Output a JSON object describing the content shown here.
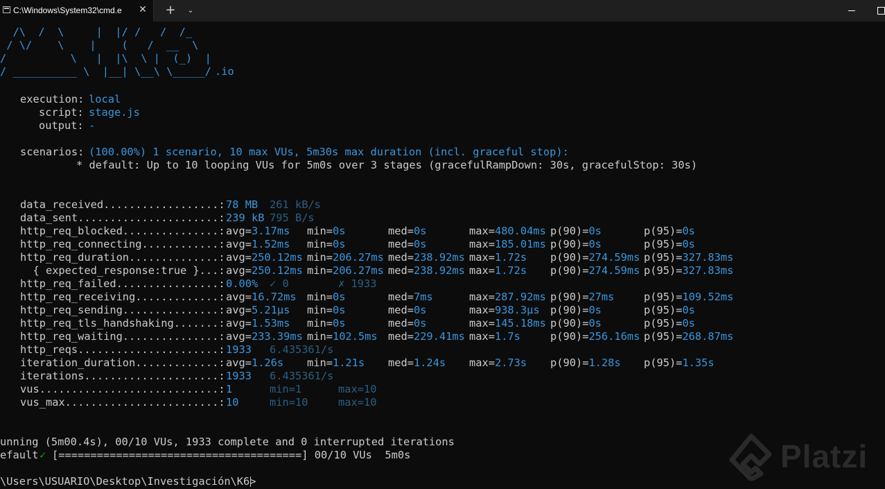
{
  "window": {
    "tab_title": "C:\\Windows\\System32\\cmd.e",
    "close_tab": "✕",
    "new_tab": "+",
    "dropdown": "⌄"
  },
  "logo": {
    "lines": [
      "  /\\  /  \\     |  |/ /   /  /_",
      " / \\/    \\    |    (   /  __  \\",
      "/          \\   |  |\\  \\ |  (_)  |",
      "/ __________ \\  |__| \\__\\ \\_____/"
    ],
    "suffix": ".io"
  },
  "run_info": {
    "execution_label": "execution:",
    "execution_value": "local",
    "script_label": "script:",
    "script_value": "stage.js",
    "output_label": "output:",
    "output_value": "-"
  },
  "scenarios": {
    "label": "scenarios:",
    "summary": "(100.00%) 1 scenario, 10 max VUs, 5m30s max duration (incl. graceful stop):",
    "detail": "* default: Up to 10 looping VUs for 5m0s over 3 stages (gracefulRampDown: 30s, gracefulStop: 30s)"
  },
  "metrics": [
    {
      "name": "data_received..................:",
      "a": "78 MB",
      "b": "261 kB/s"
    },
    {
      "name": "data_sent......................:",
      "a": "239 kB",
      "b": "795 B/s"
    },
    {
      "name": "http_req_blocked...............:",
      "avg": "3.17ms",
      "min": "0s",
      "med": "0s",
      "max": "480.04ms",
      "p90": "0s",
      "p95": "0s"
    },
    {
      "name": "http_req_connecting............:",
      "avg": "1.52ms",
      "min": "0s",
      "med": "0s",
      "max": "185.01ms",
      "p90": "0s",
      "p95": "0s"
    },
    {
      "name": "http_req_duration..............:",
      "avg": "250.12ms",
      "min": "206.27ms",
      "med": "238.92ms",
      "max": "1.72s",
      "p90": "274.59ms",
      "p95": "327.83ms"
    },
    {
      "name": "  { expected_response:true }...:",
      "avg": "250.12ms",
      "min": "206.27ms",
      "med": "238.92ms",
      "max": "1.72s",
      "p90": "274.59ms",
      "p95": "327.83ms"
    },
    {
      "name": "http_req_failed................:",
      "a": "0.00%",
      "b": "✓ 0",
      "c": "✗ 1933"
    },
    {
      "name": "http_req_receiving.............:",
      "avg": "16.72ms",
      "min": "0s",
      "med": "7ms",
      "max": "287.92ms",
      "p90": "27ms",
      "p95": "109.52ms"
    },
    {
      "name": "http_req_sending...............:",
      "avg": "5.21µs",
      "min": "0s",
      "med": "0s",
      "max": "938.3µs",
      "p90": "0s",
      "p95": "0s"
    },
    {
      "name": "http_req_tls_handshaking.......:",
      "avg": "1.53ms",
      "min": "0s",
      "med": "0s",
      "max": "145.18ms",
      "p90": "0s",
      "p95": "0s"
    },
    {
      "name": "http_req_waiting...............:",
      "avg": "233.39ms",
      "min": "102.5ms",
      "med": "229.41ms",
      "max": "1.7s",
      "p90": "256.16ms",
      "p95": "268.87ms"
    },
    {
      "name": "http_reqs......................:",
      "a": "1933",
      "b": "6.435361/s"
    },
    {
      "name": "iteration_duration.............:",
      "avg": "1.26s",
      "min": "1.21s",
      "med": "1.24s",
      "max": "2.73s",
      "p90": "1.28s",
      "p95": "1.35s"
    },
    {
      "name": "iterations.....................:",
      "a": "1933",
      "b": "6.435361/s"
    },
    {
      "name": "vus............................:",
      "a": "1",
      "b": "min=1",
      "c": "max=10"
    },
    {
      "name": "vus_max........................:",
      "a": "10",
      "b": "min=10",
      "c": "max=10"
    }
  ],
  "status": {
    "running": "unning (5m00.4s), 00/10 VUs, 1933 complete and 0 interrupted iterations",
    "default_label": "efault",
    "check": "✓",
    "progress": "[======================================] 00/10 VUs  5m0s"
  },
  "prompt": "\\Users\\USUARIO\\Desktop\\Investigación\\K6>",
  "watermark": "Platzi",
  "colors": {
    "background": "#0c0c0c",
    "text": "#cccccc",
    "accent": "#3a96dd",
    "dim": "#2c5f82",
    "success": "#13a10e"
  }
}
